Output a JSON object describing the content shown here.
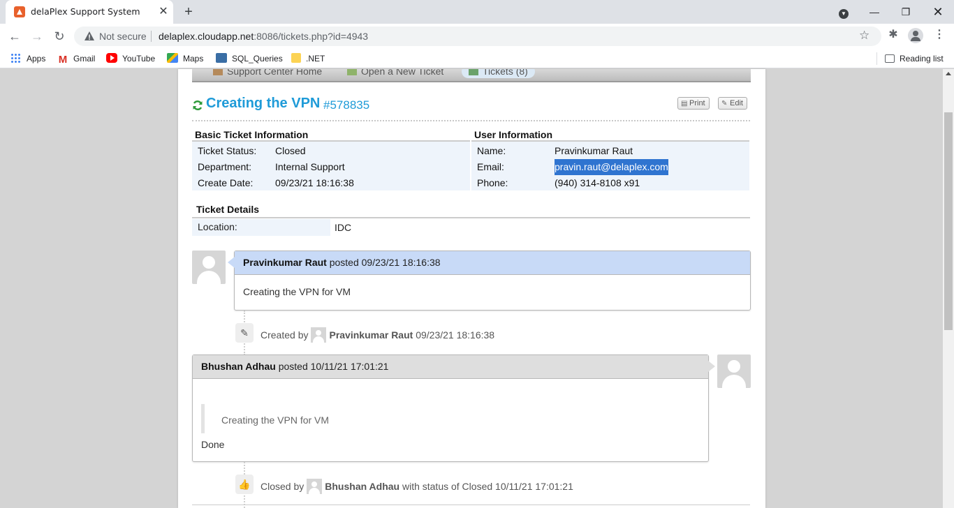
{
  "browser": {
    "tab_title": "delaPlex Support System",
    "not_secure": "Not secure",
    "url_host": "delaplex.cloudapp.net",
    "url_rest": ":8086/tickets.php?id=4943",
    "bookmarks": [
      "Apps",
      "Gmail",
      "YouTube",
      "Maps",
      "SQL_Queries",
      ".NET"
    ],
    "reading_list": "Reading list"
  },
  "nav": {
    "home": "Support Center Home",
    "new_ticket": "Open a New Ticket",
    "tickets": "Tickets (8)"
  },
  "ticket": {
    "title": "Creating the VPN",
    "number": "#578835",
    "print_label": "Print",
    "edit_label": "Edit"
  },
  "basic_info": {
    "heading": "Basic Ticket Information",
    "status_label": "Ticket Status:",
    "status_value": "Closed",
    "department_label": "Department:",
    "department_value": "Internal Support",
    "create_date_label": "Create Date:",
    "create_date_value": "09/23/21 18:16:38"
  },
  "user_info": {
    "heading": "User Information",
    "name_label": "Name:",
    "name_value": "Pravinkumar Raut",
    "email_label": "Email:",
    "email_value": "pravin.raut@delaplex.com",
    "phone_label": "Phone:",
    "phone_value": "(940) 314-8108 x91"
  },
  "details": {
    "heading": "Ticket Details",
    "location_label": "Location:",
    "location_value": "IDC"
  },
  "thread": {
    "msg1": {
      "author": "Pravinkumar Raut",
      "posted": "posted 09/23/21 18:16:38",
      "body": "Creating the VPN for VM"
    },
    "event1": {
      "prefix": "Created by",
      "author": "Pravinkumar Raut",
      "suffix": "09/23/21 18:16:38"
    },
    "msg2": {
      "author": "Bhushan Adhau",
      "posted": "posted 10/11/21 17:01:21",
      "quote": "Creating the VPN for VM",
      "body": "Done"
    },
    "event2": {
      "prefix": "Closed by",
      "author": "Bhushan Adhau",
      "suffix": "with status of Closed 10/11/21 17:01:21"
    }
  }
}
